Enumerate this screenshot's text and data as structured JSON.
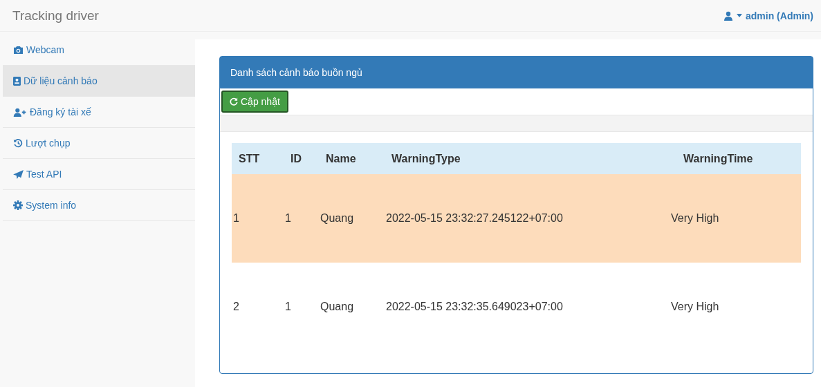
{
  "brand": "Tracking driver",
  "user": {
    "label": "admin (Admin)"
  },
  "sidebar": {
    "items": [
      {
        "label": "Webcam",
        "kind": "camera",
        "selected": false
      },
      {
        "label": "Dữ liệu cảnh báo",
        "kind": "badge",
        "selected": true
      },
      {
        "label": "Đăng ký tài xế",
        "kind": "userplus",
        "selected": false
      },
      {
        "label": "Lượt chụp",
        "kind": "history",
        "selected": false
      },
      {
        "label": "Test API",
        "kind": "send",
        "selected": false
      },
      {
        "label": "System info",
        "kind": "gear",
        "selected": false
      }
    ]
  },
  "panel": {
    "title": "Danh sách cảnh báo buồn ngủ",
    "refresh_button": "Cập nhật",
    "table": {
      "columns": [
        "STT",
        "ID",
        "Name",
        "WarningType",
        "WarningTime"
      ],
      "rows": [
        {
          "cells": [
            "1",
            "1",
            "Quang",
            "2022-05-15 23:32:27.245122+07:00",
            "Very High"
          ],
          "highlighted": true
        },
        {
          "cells": [
            "2",
            "1",
            "Quang",
            "2022-05-15 23:32:35.649023+07:00",
            "Very High"
          ],
          "highlighted": false
        }
      ]
    }
  }
}
